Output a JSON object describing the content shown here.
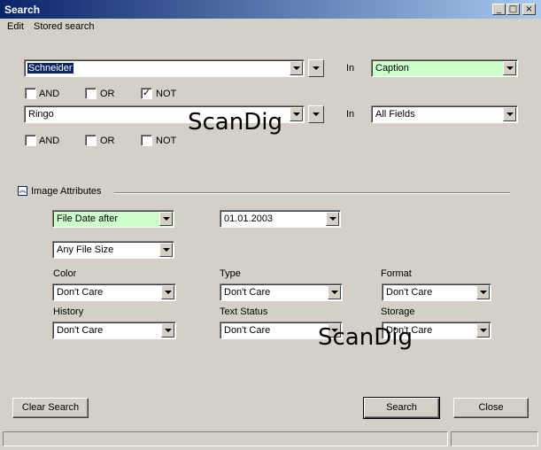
{
  "window": {
    "title": "Search",
    "buttons": {
      "minimize": "_",
      "maximize": "□",
      "close": "×"
    }
  },
  "menu": [
    {
      "label": "Edit"
    },
    {
      "label": "Stored search"
    }
  ],
  "search_rows": [
    {
      "term": "Schneider",
      "in_label": "In",
      "field": "Caption"
    },
    {
      "term": "Ringo",
      "in_label": "In",
      "field": "All Fields"
    }
  ],
  "logic1": {
    "and": "AND",
    "or": "OR",
    "not": "NOT",
    "not_checked": "✓"
  },
  "logic2": {
    "and": "AND",
    "or": "OR",
    "not": "NOT"
  },
  "image_attributes": {
    "header": "Image Attributes",
    "date_filter": "File Date after",
    "date_value": "01.01.2003",
    "file_size": "Any File Size",
    "color": {
      "label": "Color",
      "value": "Don't Care"
    },
    "type": {
      "label": "Type",
      "value": "Don't Care"
    },
    "format": {
      "label": "Format",
      "value": "Don't Care"
    },
    "history": {
      "label": "History",
      "value": "Don't Care"
    },
    "text_status": {
      "label": "Text Status",
      "value": "Don't Care"
    },
    "storage": {
      "label": "Storage",
      "value": "Don't Care"
    }
  },
  "buttons": {
    "clear": "Clear Search",
    "search": "Search",
    "close": "Close"
  },
  "watermark": "ScanDig",
  "colors": {
    "title_start": "#0a246a",
    "title_end": "#a6caf0",
    "highlight_field": "#ccffcc",
    "face": "#d4d0c8"
  }
}
